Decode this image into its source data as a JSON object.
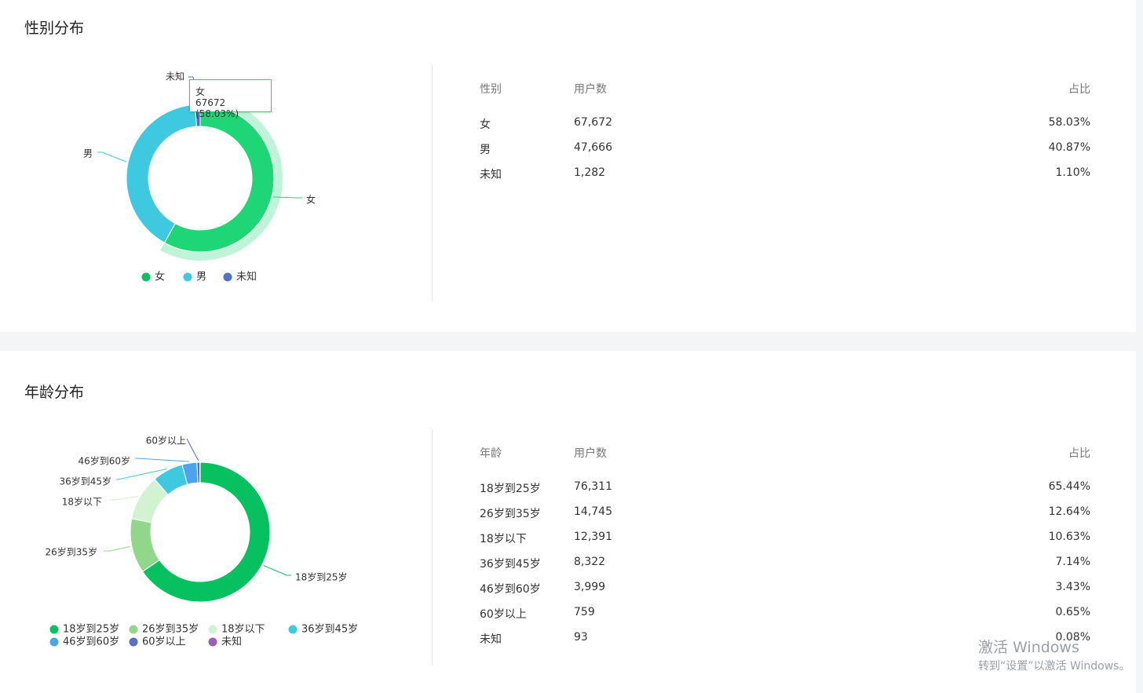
{
  "gender": {
    "title": "性别分布",
    "headers": {
      "label": "性别",
      "users": "用户数",
      "ratio": "占比"
    },
    "rows": [
      {
        "label": "女",
        "users": "67,672",
        "ratio": "58.03%"
      },
      {
        "label": "男",
        "users": "47,666",
        "ratio": "40.87%"
      },
      {
        "label": "未知",
        "users": "1,282",
        "ratio": "1.10%"
      }
    ],
    "tooltip": {
      "title": "女",
      "value": "67672 (58.03%)"
    }
  },
  "age": {
    "title": "年龄分布",
    "headers": {
      "label": "年龄",
      "users": "用户数",
      "ratio": "占比"
    },
    "rows": [
      {
        "label": "18岁到25岁",
        "users": "76,311",
        "ratio": "65.44%"
      },
      {
        "label": "26岁到35岁",
        "users": "14,745",
        "ratio": "12.64%"
      },
      {
        "label": "18岁以下",
        "users": "12,391",
        "ratio": "10.63%"
      },
      {
        "label": "36岁到45岁",
        "users": "8,322",
        "ratio": "7.14%"
      },
      {
        "label": "46岁到60岁",
        "users": "3,999",
        "ratio": "3.43%"
      },
      {
        "label": "60岁以上",
        "users": "759",
        "ratio": "0.65%"
      },
      {
        "label": "未知",
        "users": "93",
        "ratio": "0.08%"
      }
    ]
  },
  "watermark": {
    "line1": "激活 Windows",
    "line2": "转到“设置”以激活 Windows。"
  },
  "chart_data": [
    {
      "type": "pie",
      "title": "性别分布",
      "categories": [
        "女",
        "男",
        "未知"
      ],
      "values": [
        67672,
        47666,
        1282
      ],
      "colors": [
        "#1ed676",
        "#3ec9e0",
        "#5470c6"
      ],
      "legend_colors": [
        "#07c160",
        "#3ec9e0",
        "#5470c6"
      ],
      "highlighted": "女",
      "legend": "bottom"
    },
    {
      "type": "pie",
      "title": "年龄分布",
      "categories": [
        "18岁到25岁",
        "26岁到35岁",
        "18岁以下",
        "36岁到45岁",
        "46岁到60岁",
        "60岁以上",
        "未知"
      ],
      "values": [
        76311,
        14745,
        12391,
        8322,
        3999,
        759,
        93
      ],
      "colors": [
        "#07c160",
        "#91d68a",
        "#d3f2d2",
        "#3ec9e0",
        "#4ea4ea",
        "#5470c6",
        "#9a60b4"
      ],
      "legend": "bottom"
    }
  ]
}
